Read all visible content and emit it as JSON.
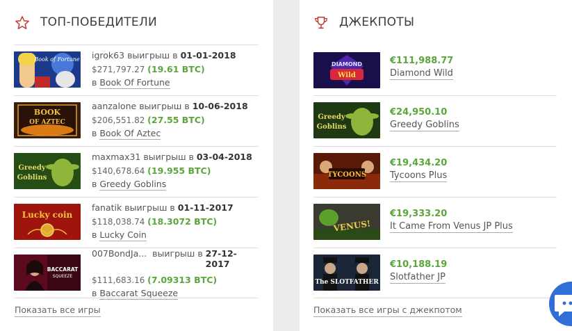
{
  "winners": {
    "title": "ТОП-ПОБЕДИТЕЛИ",
    "won_word": "выигрыш в",
    "in_word": "в",
    "show_all": "Показать все игры",
    "items": [
      {
        "user": "igrok63",
        "date": "01-01-2018",
        "usd": "$271,797.27",
        "btc": "(19.61 BTC)",
        "game": "Book Of Fortune"
      },
      {
        "user": "aanzalone",
        "date": "10-06-2018",
        "usd": "$206,551.82",
        "btc": "(27.55 BTC)",
        "game": "Book Of Aztec"
      },
      {
        "user": "maxmax31",
        "date": "03-04-2018",
        "usd": "$140,678.64",
        "btc": "(19.955 BTC)",
        "game": "Greedy Goblins"
      },
      {
        "user": "fanatik",
        "date": "01-11-2017",
        "usd": "$118,038.74",
        "btc": "(18.3072 BTC)",
        "game": "Lucky Coin"
      },
      {
        "user": "007BondJa...",
        "date": "27-12-2017",
        "usd": "$111,683.16",
        "btc": "(7.09313 BTC)",
        "game": "Baccarat Squeeze"
      }
    ]
  },
  "jackpots": {
    "title": "ДЖЕКПОТЫ",
    "show_all": "Показать все игры с джекпотом",
    "items": [
      {
        "amount": "€111,988.77",
        "game": "Diamond Wild"
      },
      {
        "amount": "€24,950.10",
        "game": "Greedy Goblins"
      },
      {
        "amount": "€19,434.20",
        "game": "Tycoons Plus"
      },
      {
        "amount": "€19,333.20",
        "game": "It Came From Venus JP Plus"
      },
      {
        "amount": "€10,188.19",
        "game": "Slotfather JP"
      }
    ]
  },
  "thumb_text": {
    "book_of_fortune": "Book of Fortune",
    "book_of_aztec_1": "BOOK",
    "book_of_aztec_2": "OF AZTEC",
    "greedy_1": "Greedy",
    "greedy_2": "Goblins",
    "lucky_coin": "Lucky coin",
    "baccarat_1": "BACCARAT",
    "baccarat_2": "SQUEEZE",
    "diamond_1": "DIAMOND",
    "diamond_2": "Wild",
    "tycoons": "TYCOONS",
    "venus": "VENUS!",
    "slotfather": "The SLOTFATHER"
  },
  "colors": {
    "accent_green": "#5aa63a",
    "icon_red": "#c0392b",
    "chat_blue": "#2f6fd6"
  },
  "icons": [
    "star-icon",
    "trophy-icon",
    "chat-icon"
  ]
}
